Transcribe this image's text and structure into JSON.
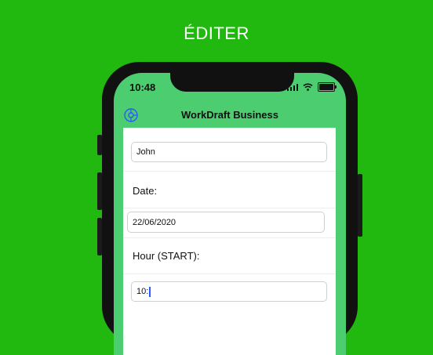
{
  "headline": "ÉDITER",
  "status_bar": {
    "time": "10:48"
  },
  "nav": {
    "title": "WorkDraft Business",
    "settings_icon": "settings-icon"
  },
  "form": {
    "name_value": "John",
    "date_label": "Date:",
    "date_value": "22/06/2020",
    "hour_start_label": "Hour (START):",
    "hour_start_value": "10:"
  },
  "colors": {
    "background": "#21b90f",
    "header": "#4ccd70",
    "caret": "#2b58ff"
  }
}
